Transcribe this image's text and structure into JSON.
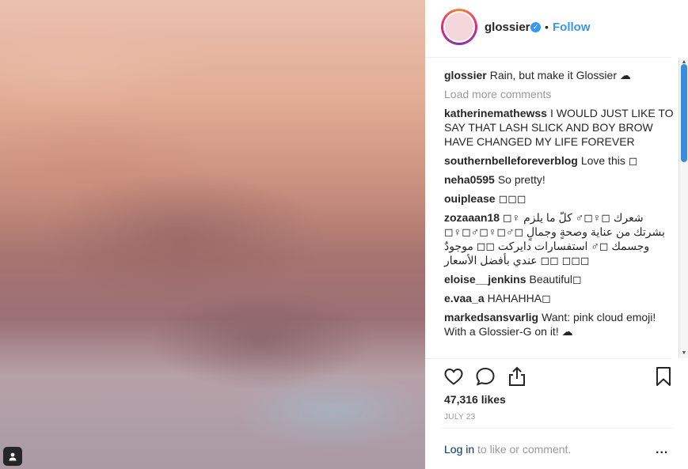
{
  "post": {
    "username": "glossier",
    "verified_glyph": "✓",
    "separator": "•",
    "follow_label": "Follow",
    "likes": "47,316 likes",
    "date": "JULY 23",
    "load_more": "Load more comments",
    "login_link": "Log in",
    "login_rest": " to like or comment.",
    "more_glyph": "..."
  },
  "comments": [
    {
      "user": "glossier",
      "text": "Rain, but make it Glossier ☁"
    },
    {
      "user": "katherinemathewss",
      "text": "I WOULD JUST LIKE TO SAY THAT LASH SLICK AND BOY BROW HAVE CHANGED MY LIFE FOREVER"
    },
    {
      "user": "southernbelleforeverblog",
      "text": "Love this ◻"
    },
    {
      "user": "neha0595",
      "text": "So pretty!"
    },
    {
      "user": "ouiplease",
      "text": "◻◻◻"
    },
    {
      "user": "zozaaan18",
      "text": "◻♀ شعرك ◻♀◻♂ كلّ ما يلزم بشرتك من عناية وصحةٍ وجمالٍ ◻♂◻♀◻♂◻♀◻ وجسمك ◻♂ استفسارات دايركت ◻◻ موجودٌ عندي بأفضل الأسعار ◻◻ ◻◻◻"
    },
    {
      "user": "eloise__jenkins",
      "text": "Beautiful◻"
    },
    {
      "user": "e.vaa_a",
      "text": "HAHAHHA◻"
    },
    {
      "user": "markedsansvarlig",
      "text": "Want: pink cloud emoji! With a Glossier-G on it! ☁"
    }
  ],
  "icons": {
    "like": "heart-icon",
    "comment": "comment-icon",
    "share": "share-icon",
    "save": "bookmark-icon",
    "user_tag": "user-tag-icon"
  },
  "colors": {
    "accent": "#3897f0",
    "muted": "#999999",
    "link": "#003569"
  }
}
